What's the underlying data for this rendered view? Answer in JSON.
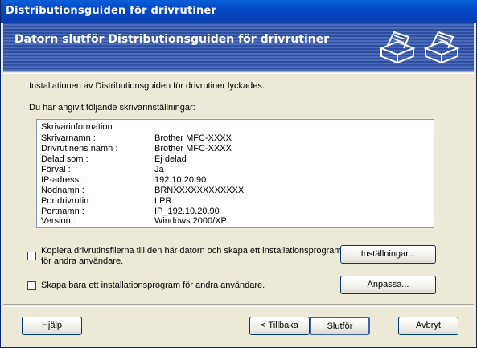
{
  "window": {
    "title": "Distributionsguiden för drivrutiner"
  },
  "banner": {
    "heading": "Datorn slutför Distributionsguiden för drivrutiner"
  },
  "messages": {
    "success": "Installationen av Distributionsguiden för drivrutiner lyckades.",
    "settings_intro": "Du har angivit följande skrivarinställningar:"
  },
  "printer_info": {
    "header": "Skrivarinformation",
    "rows": [
      {
        "label": "Skrivarnamn :",
        "value": "Brother  MFC-XXXX"
      },
      {
        "label": "Drivrutinens namn :",
        "value": "Brother  MFC-XXXX"
      },
      {
        "label": "Delad som :",
        "value": "Ej delad"
      },
      {
        "label": "Förval :",
        "value": "Ja"
      },
      {
        "label": "IP-adress :",
        "value": "192.10.20.90"
      },
      {
        "label": "Nodnamn :",
        "value": "BRNXXXXXXXXXXXX"
      },
      {
        "label": "Portdrivrutin :",
        "value": "LPR"
      },
      {
        "label": "Portnamn :",
        "value": "IP_192.10.20.90"
      },
      {
        "label": "Version :",
        "value": "Windows 2000/XP"
      }
    ]
  },
  "options": {
    "copy_drivers": {
      "label_line1": "Kopiera drivrutinsfilerna till den här datorn och skapa ett installationsprogram",
      "label_line2": "för andra användare.",
      "checked": false
    },
    "create_only": {
      "label": "Skapa bara ett installationsprogram för andra användare.",
      "checked": false
    }
  },
  "buttons": {
    "settings": "Inställningar...",
    "customize": "Anpassa...",
    "help": "Hjälp",
    "back": "< Tillbaka",
    "finish": "Slutför",
    "cancel": "Avbryt"
  },
  "icons": [
    "printer-icon",
    "printer-icon"
  ]
}
